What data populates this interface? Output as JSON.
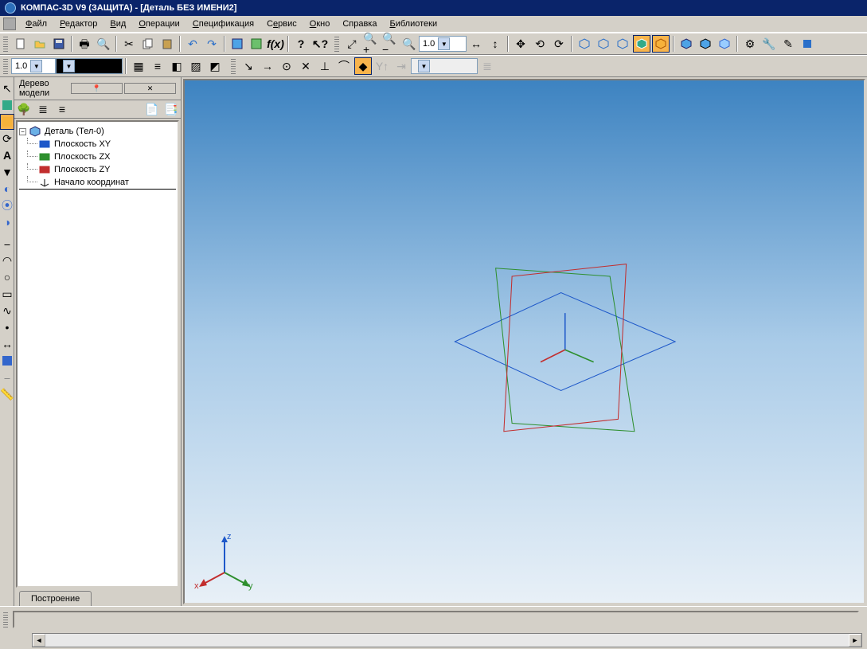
{
  "title": "КОМПАС-3D V9 (ЗАЩИТА) - [Деталь БЕЗ ИМЕНИ2]",
  "menu": [
    "Файл",
    "Редактор",
    "Вид",
    "Операции",
    "Спецификация",
    "Сервис",
    "Окно",
    "Справка",
    "Библиотеки"
  ],
  "combo_scale1": "1.0",
  "combo_scale2": "1.0",
  "combo_color": "",
  "tree_panel_title": "Дерево модели",
  "tree_root": "Деталь (Тел-0)",
  "tree_items": [
    {
      "label": "Плоскость XY",
      "color": "#1e58c9"
    },
    {
      "label": "Плоскость ZX",
      "color": "#2e8f2e"
    },
    {
      "label": "Плоскость ZY",
      "color": "#c22e2e"
    },
    {
      "label": "Начало координат",
      "color": "#000"
    }
  ],
  "tab_label": "Построение",
  "axis_labels": {
    "x": "x",
    "y": "y",
    "z": "z"
  }
}
